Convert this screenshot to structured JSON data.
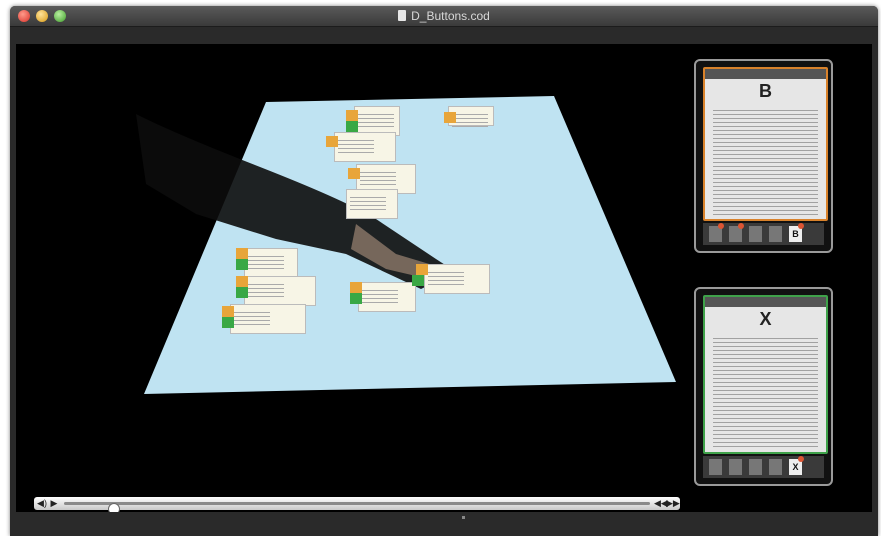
{
  "window": {
    "title": "D_Buttons.cod"
  },
  "titlebar": {
    "buttons": [
      "close",
      "minimize",
      "zoom"
    ]
  },
  "colors": {
    "orange_tag": "#e8a53a",
    "green_tag": "#39a845",
    "panel_b_border": "#d9822b",
    "panel_x_border": "#3fa24a"
  },
  "player": {
    "progress": 0.05,
    "icons": {
      "volume": "speaker-icon",
      "play": "play-icon",
      "rewind": "rewind-icon",
      "forward": "forward-icon"
    }
  },
  "panels": [
    {
      "letter": "B",
      "accent": "orange"
    },
    {
      "letter": "X",
      "accent": "green"
    }
  ]
}
